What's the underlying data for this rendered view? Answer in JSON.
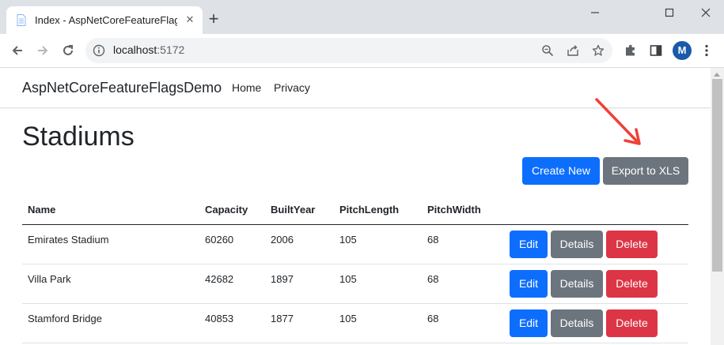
{
  "browser": {
    "tab_title": "Index - AspNetCoreFeatureFlagsD",
    "url_host": "localhost",
    "url_port": ":5172",
    "avatar_letter": "M",
    "accent": "#1a5aa9"
  },
  "app": {
    "brand": "AspNetCoreFeatureFlagsDemo",
    "nav": [
      "Home",
      "Privacy"
    ]
  },
  "page": {
    "title": "Stadiums",
    "create_label": "Create New",
    "export_label": "Export to XLS"
  },
  "table": {
    "columns": [
      "Name",
      "Capacity",
      "BuiltYear",
      "PitchLength",
      "PitchWidth"
    ],
    "rows": [
      {
        "name": "Emirates Stadium",
        "capacity": "60260",
        "built_year": "2006",
        "pitch_length": "105",
        "pitch_width": "68"
      },
      {
        "name": "Villa Park",
        "capacity": "42682",
        "built_year": "1897",
        "pitch_length": "105",
        "pitch_width": "68"
      },
      {
        "name": "Stamford Bridge",
        "capacity": "40853",
        "built_year": "1877",
        "pitch_length": "105",
        "pitch_width": "68"
      }
    ],
    "actions": {
      "edit": "Edit",
      "details": "Details",
      "delete": "Delete"
    }
  },
  "colors": {
    "primary": "#0d6efd",
    "secondary": "#6c757d",
    "danger": "#dc3545",
    "annotation_arrow": "#ef4136"
  },
  "icons": {
    "back": "arrow-left-icon",
    "forward": "arrow-right-icon",
    "reload": "reload-icon",
    "info": "info-icon",
    "zoom": "zoom-icon",
    "share": "share-icon",
    "bookmark": "star-icon",
    "extensions": "puzzle-icon",
    "sidepanel": "side-panel-icon",
    "menu": "kebab-menu-icon"
  }
}
